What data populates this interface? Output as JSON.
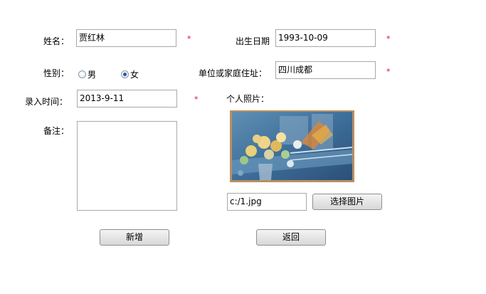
{
  "form": {
    "name_label": "姓名：",
    "name_value": "贾红林",
    "required_mark": "*",
    "birth_label": "出生日期",
    "birth_value": "1993-10-09",
    "gender_label": "性别：",
    "gender_male": "男",
    "gender_female": "女",
    "gender_selected": "女",
    "address_label": "单位或家庭住址：",
    "address_value": "四川成都",
    "entry_label": "录入时间：",
    "entry_value": "2013-9-11",
    "photo_label": "个人照片：",
    "remark_label": "备注：",
    "remark_value": "",
    "photo_path_value": "c:/1.jpg",
    "choose_photo_button": "选择图片",
    "add_button": "新增",
    "back_button": "返回"
  },
  "colors": {
    "required": "#d0102a",
    "border": "#a9a9a9"
  },
  "icons": {
    "photo": "flower-painting-image"
  }
}
